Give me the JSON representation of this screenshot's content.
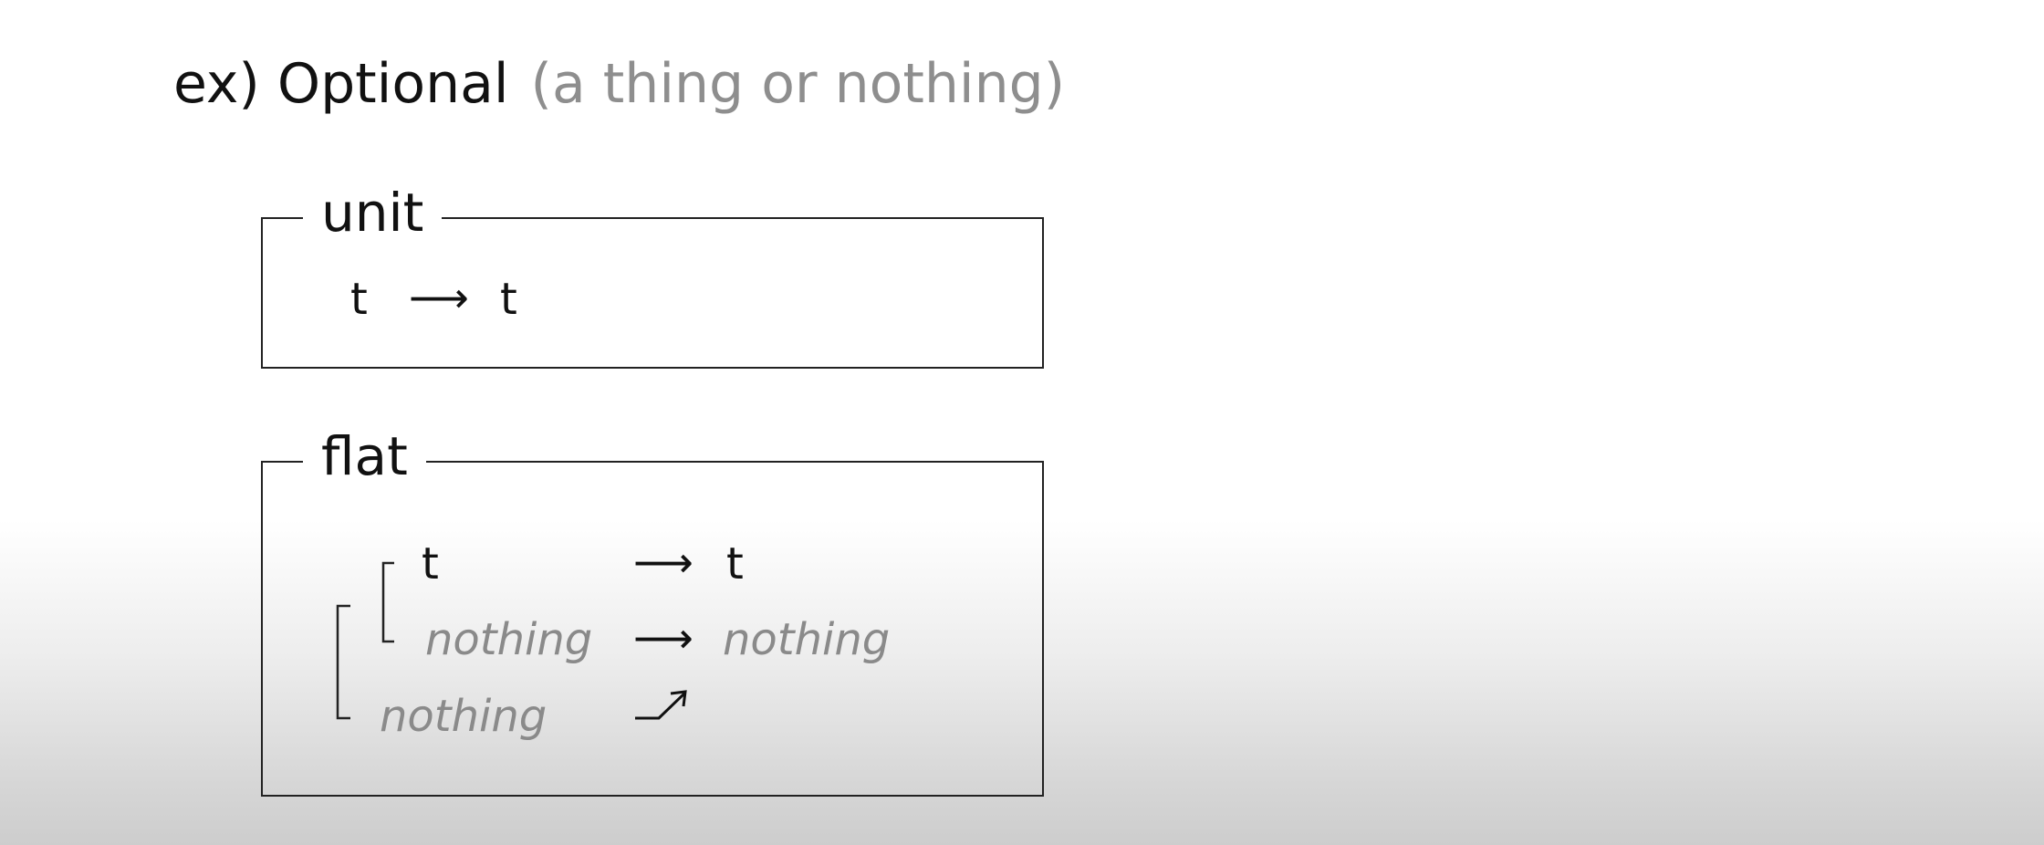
{
  "title": {
    "main": "ex) Optional",
    "subtitle": "(a thing or nothing)"
  },
  "unit": {
    "label": "unit",
    "from": "t",
    "arrow": "⟶",
    "to": "t"
  },
  "flat": {
    "label": "flat",
    "rows": [
      {
        "from": "t",
        "arrow": "⟶",
        "to": "t"
      },
      {
        "from": "nothing",
        "arrow": "⟶",
        "to": "nothing"
      },
      {
        "from": "nothing",
        "arrow": "",
        "to": ""
      }
    ]
  },
  "colors": {
    "text": "#111111",
    "muted": "#8a8a8a",
    "border": "#222222"
  },
  "icons": {
    "inner_bracket": "bracket-inner-icon",
    "outer_bracket": "bracket-outer-icon",
    "merge_arrow": "merge-arrow-icon"
  }
}
